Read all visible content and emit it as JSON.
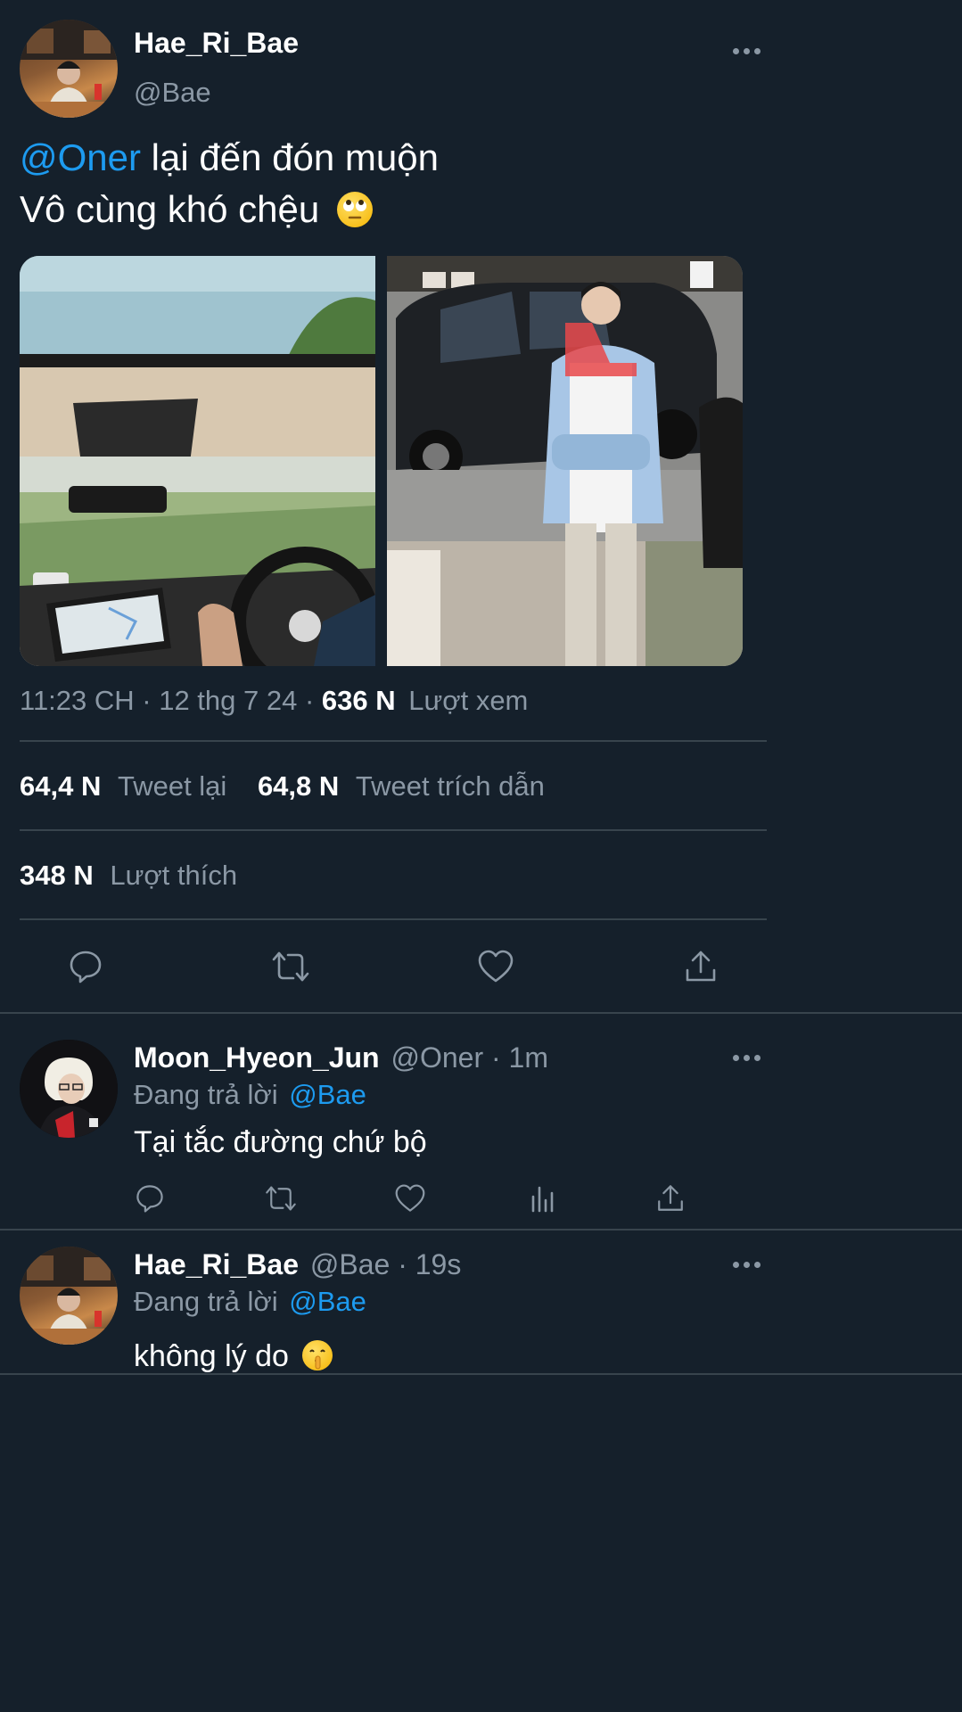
{
  "main_tweet": {
    "display_name": "Hae_Ri_Bae",
    "handle": "@Bae",
    "mention": "@Oner",
    "line1_rest": " lại đến đón muộn",
    "line2": "Vô cùng khó chệu",
    "line2_emoji": "face-with-rolling-eyes",
    "meta_time": "11:23 CH · 12 thg 7 24 · ",
    "views_count": "636 N",
    "views_label": "Lượt xem",
    "retweets_count": "64,4 N",
    "retweets_label": "Tweet lại",
    "quotes_count": "64,8 N",
    "quotes_label": "Tweet trích dẫn",
    "likes_count": "348 N",
    "likes_label": "Lượt thích"
  },
  "replies": [
    {
      "display_name": "Moon_Hyeon_Jun",
      "handle_time": "@Oner · 1m",
      "replying_label": "Đang trả lời",
      "replying_to": "@Bae",
      "text": "Tại tắc đường chứ bộ"
    },
    {
      "display_name": "Hae_Ri_Bae",
      "handle_time": "@Bae · 19s",
      "replying_label": "Đang trả lời",
      "replying_to": "@Bae",
      "text": "không lý do",
      "emoji": "shushing-face"
    }
  ],
  "colors": {
    "background": "#15202b",
    "accent": "#1d9bf0",
    "muted": "#8b98a5",
    "divider": "#38444d"
  }
}
